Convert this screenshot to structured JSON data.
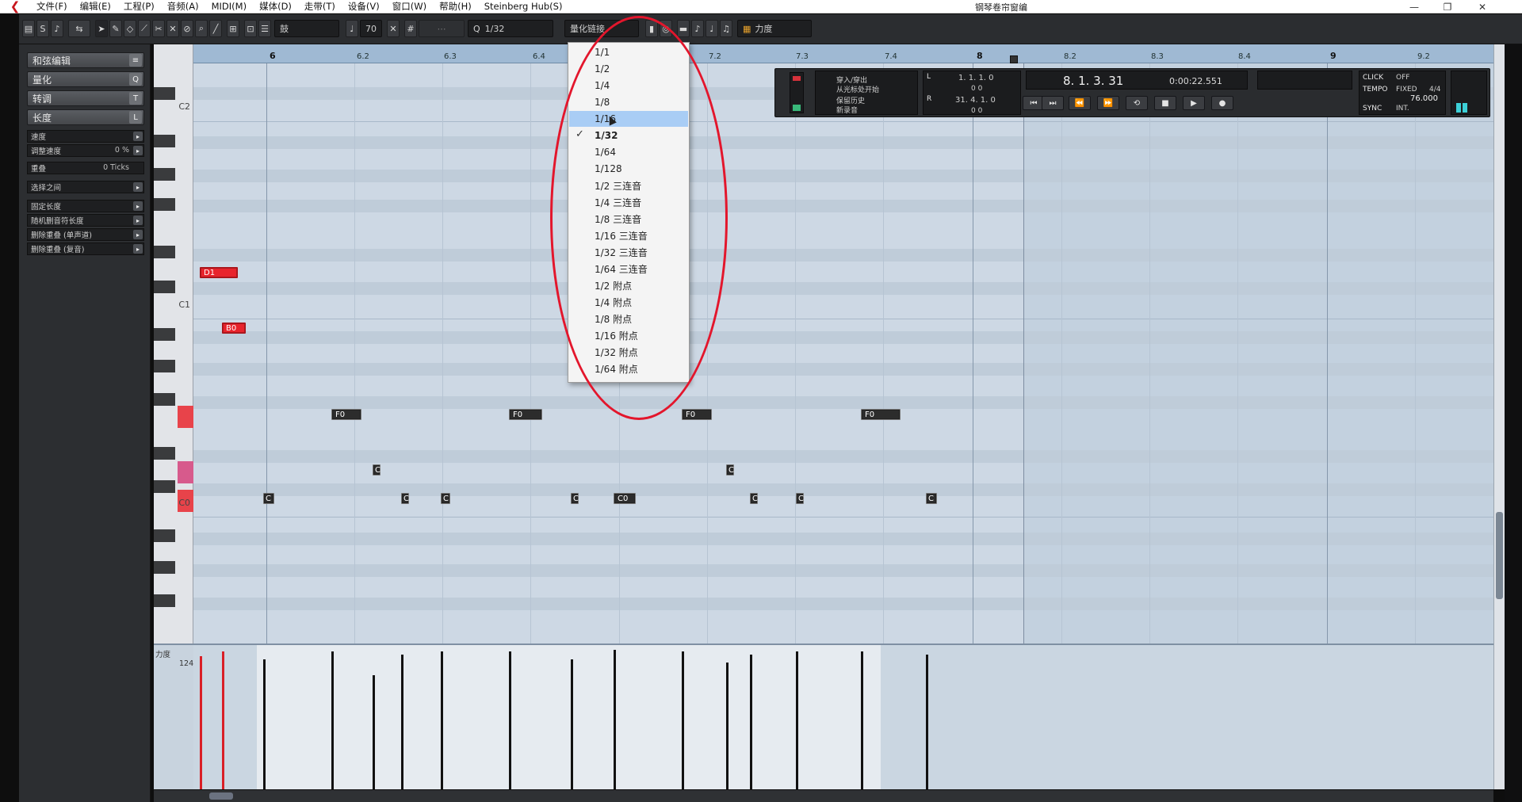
{
  "window": {
    "title": "钢琴卷帘窗编"
  },
  "menu": [
    "文件(F)",
    "编辑(E)",
    "工程(P)",
    "音频(A)",
    "MIDI(M)",
    "媒体(D)",
    "走带(T)",
    "设备(V)",
    "窗口(W)",
    "帮助(H)",
    "Steinberg Hub(S)"
  ],
  "toolbar": {
    "tool_field": "鼓",
    "step_value": "70",
    "quantize_value": "1/32",
    "quantize_link": "量化链接",
    "velocity_lane": "力度",
    "quantize_prefix": "Q"
  },
  "left_panel": {
    "sections": [
      "和弦编辑",
      "量化",
      "转调",
      "长度"
    ],
    "section_icons": [
      "≡",
      "Q",
      "T",
      "L"
    ],
    "rows": [
      {
        "label": "速度",
        "value": ""
      },
      {
        "label": "调整速度",
        "value": "0 %"
      },
      {
        "label": "重叠",
        "value": "0 Ticks"
      },
      {
        "label": "选择之间",
        "value": ""
      },
      {
        "label": "固定长度",
        "value": ""
      },
      {
        "label": "随机删音符长度",
        "value": ""
      },
      {
        "label": "删除重叠 (单声道)",
        "value": ""
      },
      {
        "label": "删除重叠 (复音)",
        "value": ""
      }
    ]
  },
  "keyboard": {
    "labels": [
      "C2",
      "C1",
      "C0"
    ]
  },
  "ruler": {
    "labels": [
      "6",
      "6.2",
      "6.3",
      "6.4",
      "7.2",
      "7.3",
      "7.4",
      "8",
      "8.2",
      "8.3",
      "8.4",
      "9",
      "9.2"
    ]
  },
  "notes": [
    {
      "label": "D1",
      "color": "red"
    },
    {
      "label": "B0",
      "color": "red"
    },
    {
      "label": "F0",
      "color": "black"
    },
    {
      "label": "F0",
      "color": "black"
    },
    {
      "label": "F0",
      "color": "black"
    },
    {
      "label": "F0",
      "color": "black"
    },
    {
      "label": "C",
      "color": "black"
    },
    {
      "label": "C",
      "color": "black"
    },
    {
      "label": "C",
      "color": "black"
    },
    {
      "label": "C",
      "color": "black"
    },
    {
      "label": "C",
      "color": "black"
    },
    {
      "label": "C",
      "color": "black"
    },
    {
      "label": "C",
      "color": "black"
    },
    {
      "label": "C",
      "color": "black"
    },
    {
      "label": "C0",
      "color": "black"
    },
    {
      "label": "C",
      "color": "black"
    },
    {
      "label": "C",
      "color": "black"
    },
    {
      "label": "C",
      "color": "black"
    }
  ],
  "transport": {
    "punch_in_out": "穿入/穿出",
    "from_cursor": "从光标处开始",
    "keep_history": "保留历史",
    "new_record": "新录音",
    "left_locator": "1. 1. 1. 0",
    "left_sub": "0   0",
    "right_locator": "31. 4. 1. 0",
    "right_sub": "0   0",
    "position": "8. 1. 3. 31",
    "time": "0:00:22.551",
    "click_label": "CLICK",
    "click_value": "OFF",
    "tempo_label": "TEMPO",
    "tempo_mode": "FIXED",
    "signature": "4/4",
    "tempo_value": "76.000",
    "sync_label": "SYNC",
    "sync_value": "INT."
  },
  "velocity": {
    "lane_label": "力度",
    "max_value": "124"
  },
  "dropdown": {
    "items": [
      "1/1",
      "1/2",
      "1/4",
      "1/8",
      "1/16",
      "1/32",
      "1/64",
      "1/128",
      "1/2  三连音",
      "1/4  三连音",
      "1/8  三连音",
      "1/16  三连音",
      "1/32  三连音",
      "1/64  三连音",
      "1/2  附点",
      "1/4  附点",
      "1/8  附点",
      "1/16  附点",
      "1/32  附点",
      "1/64  附点"
    ],
    "highlighted": "1/16",
    "checked": "1/32",
    "check_glyph": "✓"
  },
  "colors": {
    "accent_red": "#e8242c",
    "grid_bg": "#cdd8e4",
    "highlight": "#a9cdf5"
  }
}
